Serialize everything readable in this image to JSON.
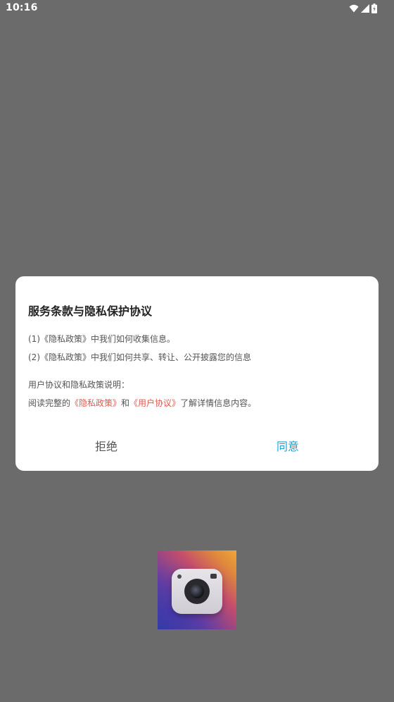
{
  "status_bar": {
    "time": "10:16"
  },
  "dialog": {
    "title": "服务条款与隐私保护协议",
    "line1": "(1)《隐私政策》中我们如何收集信息。",
    "line2": "(2)《隐私政策》中我们如何共享、转让、公开披露您的信息",
    "line3": "用户协议和隐私政策说明：",
    "line4": {
      "prefix": "阅读完整的",
      "privacy_link": "《隐私政策》",
      "middle": "和",
      "user_agreement_link": "《用户协议》",
      "suffix": "了解详情信息内容。"
    },
    "reject_label": "拒绝",
    "agree_label": "同意"
  },
  "colors": {
    "overlay": "#6b6b6b",
    "link": "#e0584f",
    "agree": "#18a6d8"
  }
}
